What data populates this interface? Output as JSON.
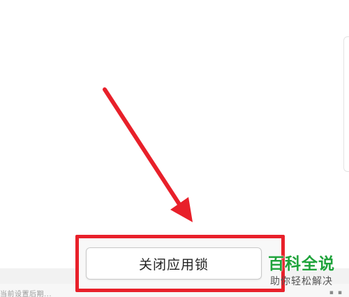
{
  "main": {
    "close_lock_button_label": "关闭应用锁"
  },
  "footer": {
    "hint_text": "当前设置后期..."
  },
  "annotation": {
    "arrow_color": "#e8202a",
    "highlight_color": "#e8202a"
  },
  "watermark": {
    "title": "百科全说",
    "subtitle": "助你轻松解决",
    "color": "#1fa33b"
  }
}
